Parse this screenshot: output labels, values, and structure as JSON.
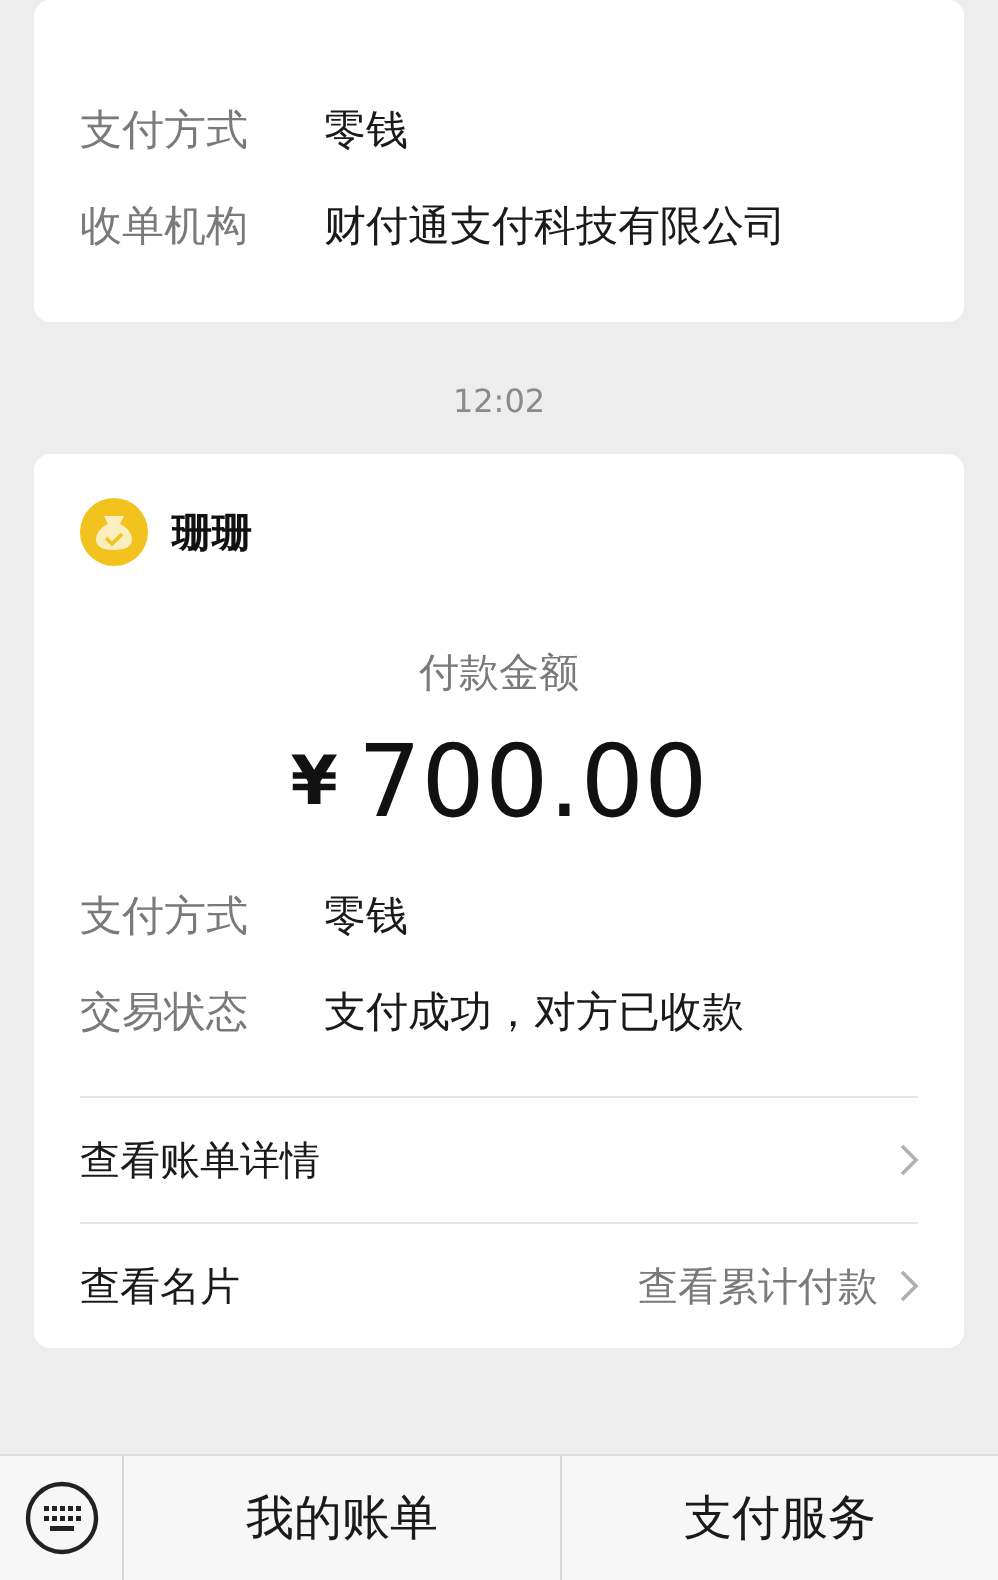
{
  "previous_card": {
    "rows": [
      {
        "label": "支付方式",
        "value": "零钱"
      },
      {
        "label": "收单机构",
        "value": "财付通支付科技有限公司"
      }
    ]
  },
  "timestamp": "12:02",
  "payment_card": {
    "payee": "珊珊",
    "amount_label": "付款金额",
    "currency": "¥",
    "amount": "700.00",
    "rows": [
      {
        "label": "支付方式",
        "value": "零钱"
      },
      {
        "label": "交易状态",
        "value": "支付成功，对方已收款"
      }
    ],
    "links": [
      {
        "label": "查看账单详情"
      },
      {
        "label": "查看名片",
        "extra": "查看累计付款"
      }
    ]
  },
  "bottom_bar": {
    "items": [
      {
        "label": "我的账单"
      },
      {
        "label": "支付服务"
      }
    ]
  }
}
